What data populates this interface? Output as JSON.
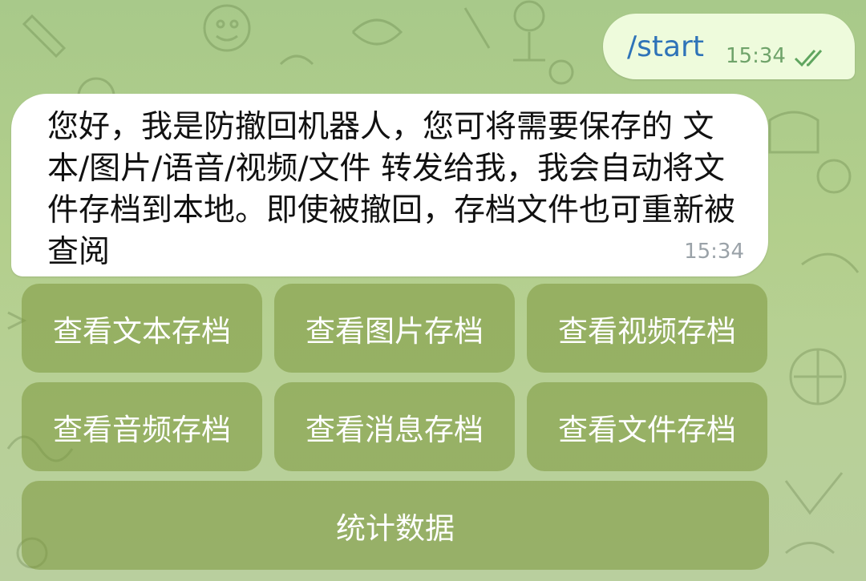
{
  "outgoing": {
    "text": "/start",
    "time": "15:34",
    "status_icon": "double-check-icon"
  },
  "incoming": {
    "text": "您好，我是防撤回机器人，您可将需要保存的 文本/图片/语音/视频/文件 转发给我，我会自动将文件存档到本地。即使被撤回，存档文件也可重新被查阅",
    "time": "15:34"
  },
  "keyboard": {
    "rows": [
      [
        "查看文本存档",
        "查看图片存档",
        "查看视频存档"
      ],
      [
        "查看音频存档",
        "查看消息存档",
        "查看文件存档"
      ],
      [
        "统计数据"
      ]
    ]
  },
  "colors": {
    "wallpaper": "#b3cf8c",
    "outgoing_bubble": "#eefbdc",
    "incoming_bubble": "#ffffff",
    "command_link": "#2e73b8",
    "read_checks": "#6fa36a",
    "keyboard_button": "#8fa957"
  }
}
